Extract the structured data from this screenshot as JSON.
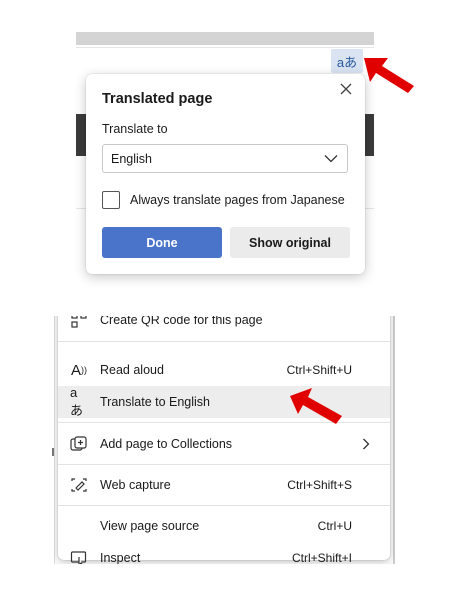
{
  "browser": {
    "translate_button_glyph": "aあ"
  },
  "flyout": {
    "title": "Translated page",
    "translate_to_label": "Translate to",
    "language_selected": "English",
    "checkbox_label": "Always translate pages from Japanese",
    "checkbox_checked": false,
    "done_label": "Done",
    "show_original_label": "Show original",
    "colors": {
      "done_bg": "#4a74c9",
      "translate_btn_bg": "#d9e3f1"
    }
  },
  "context_menu": {
    "items": [
      {
        "label": "Create QR code for this page",
        "shortcut": "",
        "icon": "qr-icon"
      },
      {
        "label": "Read aloud",
        "shortcut": "Ctrl+Shift+U",
        "icon": "read-aloud-icon"
      },
      {
        "label": "Translate to English",
        "shortcut": "",
        "icon": "translate-icon",
        "icon_glyph": "aあ",
        "highlighted": true
      },
      {
        "label": "Add page to Collections",
        "shortcut": "",
        "icon": "collections-icon",
        "has_submenu": true
      },
      {
        "label": "Web capture",
        "shortcut": "Ctrl+Shift+S",
        "icon": "web-capture-icon"
      },
      {
        "label": "View page source",
        "shortcut": "Ctrl+U",
        "icon": ""
      },
      {
        "label": "Inspect",
        "shortcut": "Ctrl+Shift+I",
        "icon": "inspect-icon"
      }
    ]
  },
  "annotations": {
    "arrow_color": "#e00000"
  }
}
